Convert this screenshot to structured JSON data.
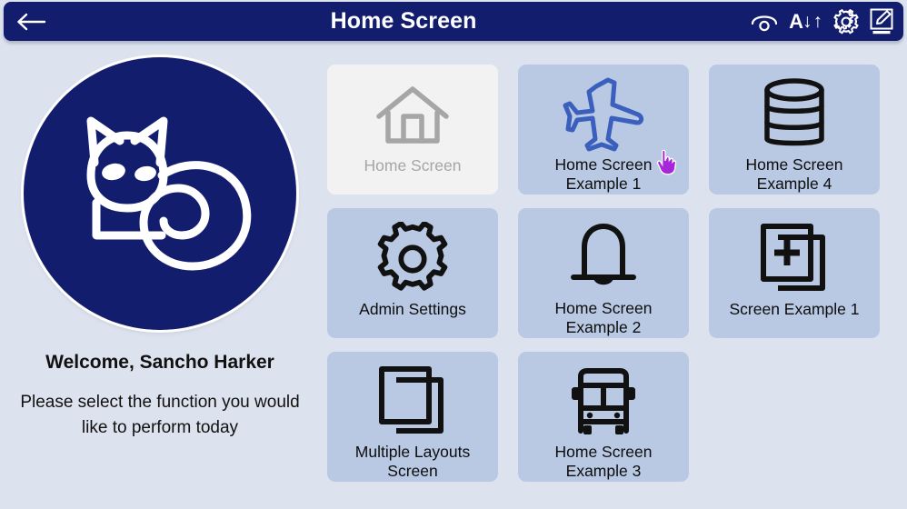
{
  "header": {
    "title": "Home Screen",
    "back_icon": "arrow-left-icon",
    "tools": [
      {
        "name": "contrast-visibility-icon",
        "label": ""
      },
      {
        "name": "font-size-icon",
        "label": "A",
        "arrows": "↓↑"
      },
      {
        "name": "gear-icon",
        "label": ""
      },
      {
        "name": "edit-notepad-icon",
        "label": ""
      }
    ]
  },
  "sidebar": {
    "logo_icon": "cat-logo-icon",
    "welcome": "Welcome, Sancho Harker",
    "subtitle": "Please select the function you would like to perform today"
  },
  "grid": {
    "tiles": [
      {
        "label": "Home Screen",
        "icon": "house-icon",
        "state": "disabled"
      },
      {
        "label": "Home Screen\nExample 1",
        "icon": "airplane-icon",
        "state": "active"
      },
      {
        "label": "Home Screen\nExample 4",
        "icon": "database-icon",
        "state": "active"
      },
      {
        "label": "Admin Settings",
        "icon": "gear-icon",
        "state": "active"
      },
      {
        "label": "Home Screen\nExample 2",
        "icon": "bell-icon",
        "state": "active"
      },
      {
        "label": "Screen Example 1",
        "icon": "add-page-icon",
        "state": "active"
      },
      {
        "label": "Multiple Layouts\nScreen",
        "icon": "stacked-pages-icon",
        "state": "active"
      },
      {
        "label": "Home Screen\nExample 3",
        "icon": "bus-icon",
        "state": "active"
      }
    ]
  },
  "cursor": {
    "name": "pointing-hand-cursor",
    "color": "#a626d9"
  },
  "colors": {
    "header_bg": "#131d6e",
    "page_bg": "#dde3ee",
    "tile_bg": "#b9c9e4",
    "tile_disabled_bg": "#f2f2f2",
    "tile_disabled_fg": "#a6a6a6",
    "airplane_blue": "#3a5fbd",
    "icon_black": "#111111"
  }
}
